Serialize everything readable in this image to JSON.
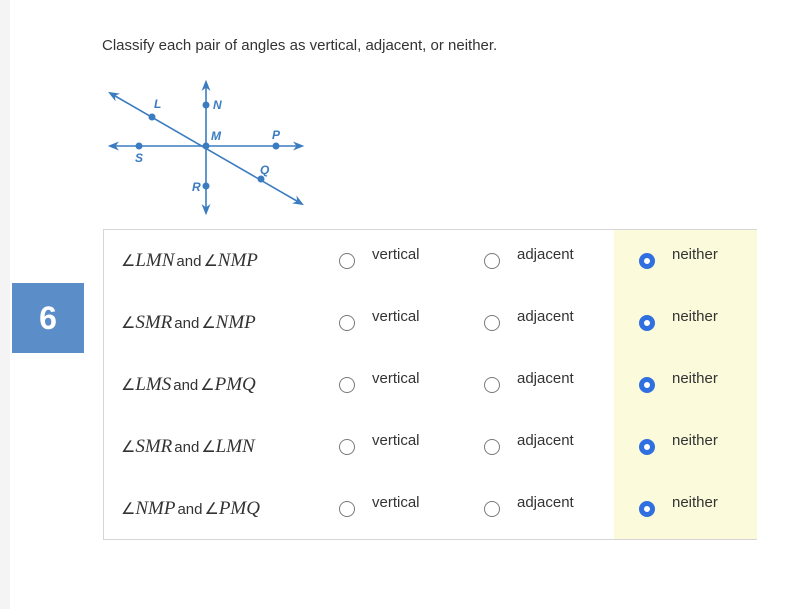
{
  "question": {
    "number": "6",
    "prompt": "Classify each pair of angles as vertical, adjacent, or neither."
  },
  "diagram": {
    "color": "#3b7cc1",
    "points": [
      "L",
      "N",
      "M",
      "P",
      "S",
      "Q",
      "R"
    ]
  },
  "options": [
    "vertical",
    "adjacent",
    "neither"
  ],
  "rows": [
    {
      "angle1": "LMN",
      "angle2": "NMP",
      "conjunction": "and",
      "selected": "neither"
    },
    {
      "angle1": "SMR",
      "angle2": "NMP",
      "conjunction": "and",
      "selected": "neither"
    },
    {
      "angle1": "LMS",
      "angle2": "PMQ",
      "conjunction": "and",
      "selected": "neither"
    },
    {
      "angle1": "SMR",
      "angle2": "LMN",
      "conjunction": "and",
      "selected": "neither"
    },
    {
      "angle1": "NMP",
      "angle2": "PMQ",
      "conjunction": "and",
      "selected": "neither"
    }
  ],
  "angle_symbol": "∠",
  "colors": {
    "badge": "#5b8ec9",
    "radio_checked": "#2f6fdf",
    "highlight": "#fbfadb"
  }
}
